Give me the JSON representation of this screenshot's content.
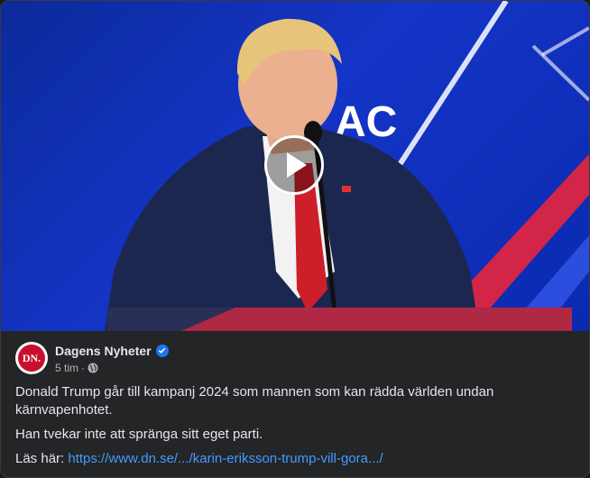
{
  "video": {
    "backdrop_text": "AC",
    "accent_colors": {
      "background": "#1434c6",
      "stripe_red": "#e8253c",
      "suit": "#1c2750",
      "tie": "#cc1f2a"
    }
  },
  "post": {
    "page_name": "Dagens Nyheter",
    "avatar_text": "DN.",
    "time": "5 tim",
    "separator": "·",
    "body_line1": "Donald Trump går till kampanj 2024 som mannen som kan rädda världen undan kärnvapenhotet.",
    "body_line2": "Han tvekar inte att spränga sitt eget parti.",
    "link_prefix": "Läs här:",
    "link_text": "https://www.dn.se/.../karin-eriksson-trump-vill-gora.../"
  },
  "icons": {
    "play": "play-icon",
    "verified": "verified-badge-icon",
    "audience": "globe-icon"
  }
}
